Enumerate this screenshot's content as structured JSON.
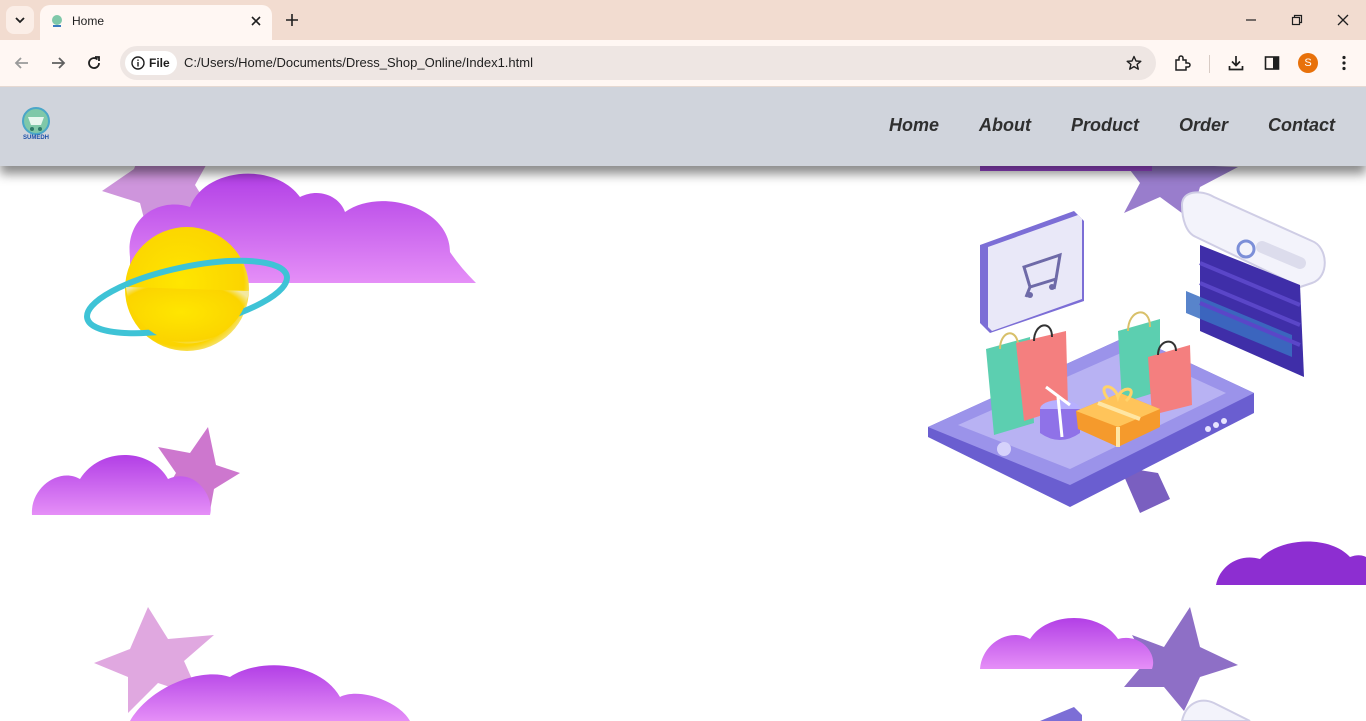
{
  "browser": {
    "tab": {
      "title": "Home"
    },
    "omnibox": {
      "chip_label": "File",
      "url": "C:/Users/Home/Documents/Dress_Shop_Online/Index1.html"
    },
    "profile_initial": "S",
    "icons": [
      "tab-search-icon",
      "close-icon",
      "plus-icon",
      "minimize-icon",
      "restore-icon",
      "close-window-icon",
      "back-icon",
      "forward-icon",
      "reload-icon",
      "info-icon",
      "star-icon",
      "extensions-icon",
      "download-icon",
      "side-panel-icon",
      "more-icon"
    ]
  },
  "site": {
    "logo_text": "SUMEDH",
    "nav": [
      {
        "label": "Home"
      },
      {
        "label": "About"
      },
      {
        "label": "Product"
      },
      {
        "label": "Order"
      },
      {
        "label": "Contact"
      }
    ]
  },
  "colors": {
    "tabstrip": "#f2dcd0",
    "toolbar": "#fff7f3",
    "navbar": "#d0d4dc",
    "cloud_purple": "#c455f0",
    "planet_yellow": "#ffe000",
    "ring_teal": "#3ec3d6",
    "avatar": "#e8710a"
  }
}
